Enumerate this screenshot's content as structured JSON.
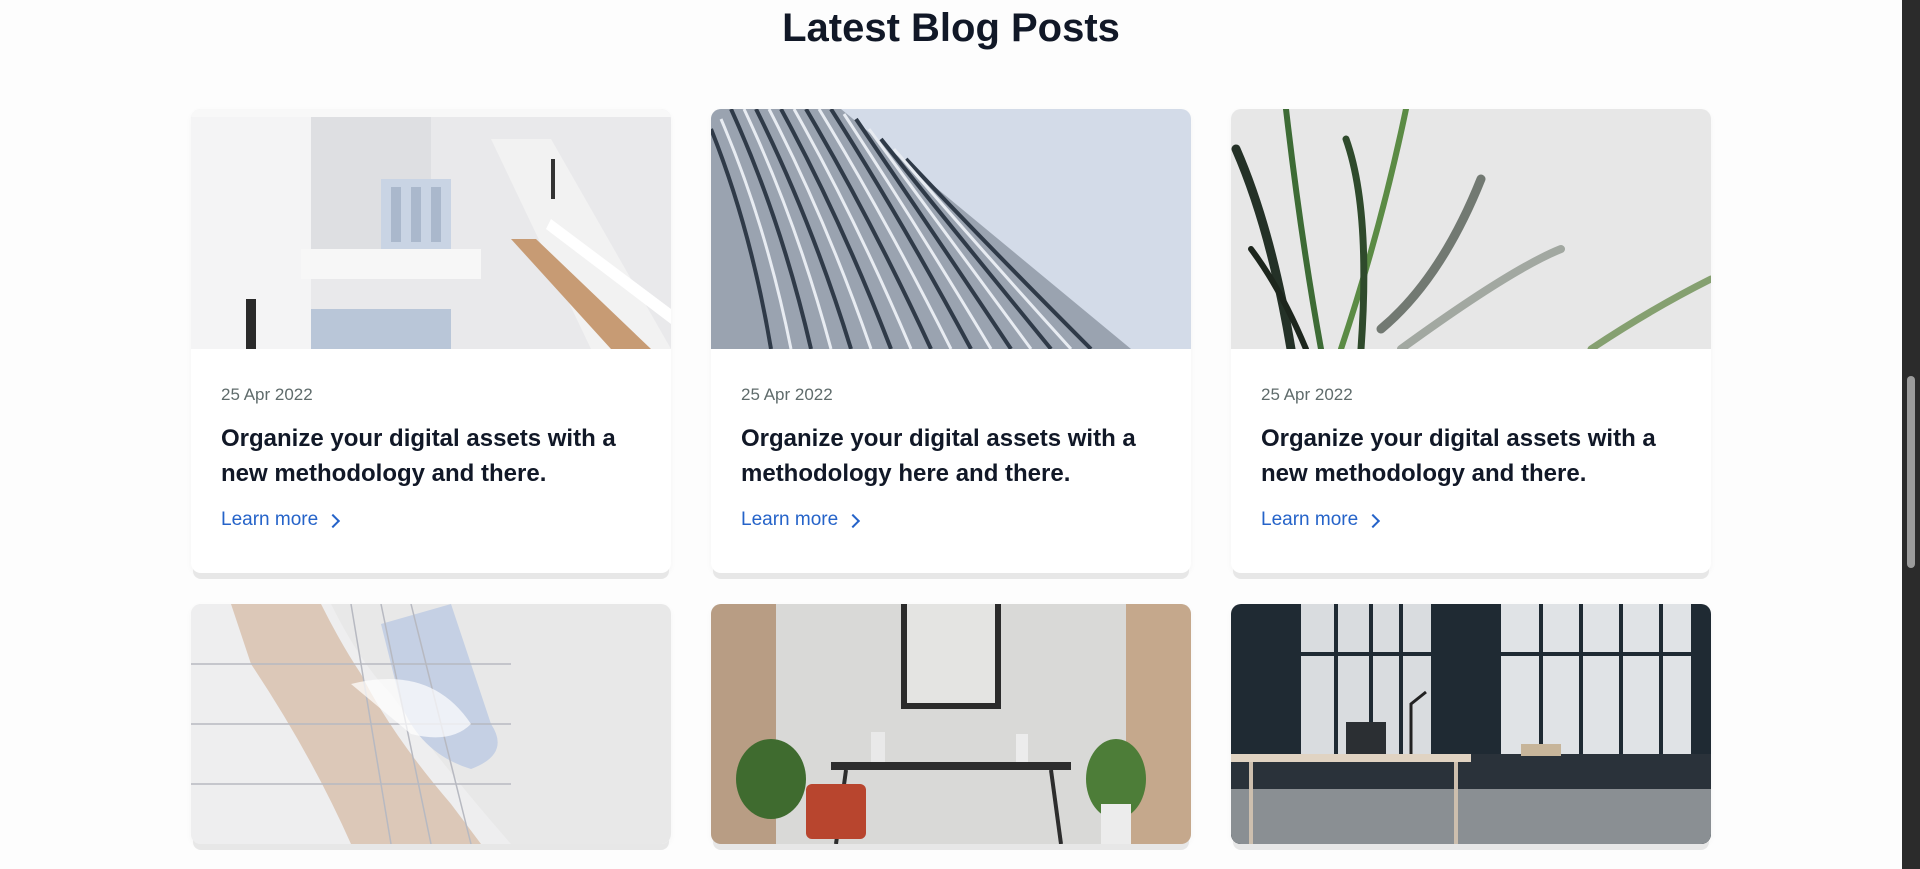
{
  "section": {
    "title": "Latest Blog Posts"
  },
  "posts": [
    {
      "date": "25 Apr 2022",
      "title": "Organize your digital assets with a new methodology and there.",
      "link_label": "Learn more",
      "image_icon": "stairwell-architecture-image"
    },
    {
      "date": "25 Apr 2022",
      "title": "Organize your digital assets with a methodology here and there.",
      "link_label": "Learn more",
      "image_icon": "curved-facade-image"
    },
    {
      "date": "25 Apr 2022",
      "title": "Organize your digital assets with a new methodology and there.",
      "link_label": "Learn more",
      "image_icon": "plant-leaves-image"
    },
    {
      "image_icon": "modern-building-image"
    },
    {
      "image_icon": "interior-desk-image"
    },
    {
      "image_icon": "office-window-image"
    }
  ],
  "colors": {
    "link": "#2563c9",
    "title": "#111827",
    "date": "#5f6b6b",
    "background": "#fdfdfd"
  }
}
